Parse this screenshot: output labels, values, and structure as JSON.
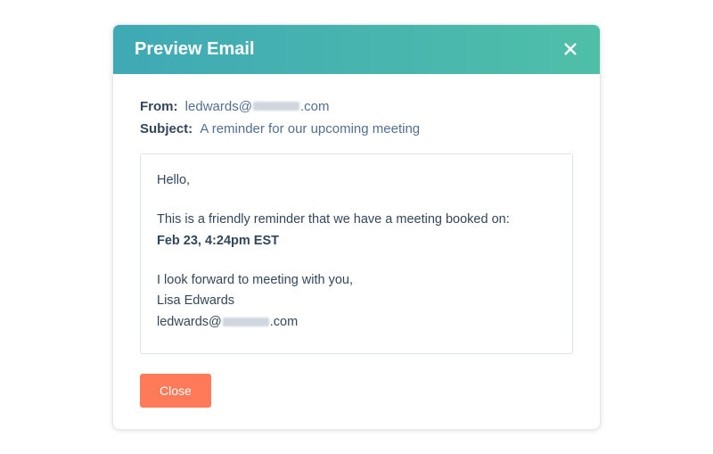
{
  "modal": {
    "title": "Preview Email",
    "from_label": "From:",
    "from_prefix": "ledwards@",
    "from_suffix": ".com",
    "subject_label": "Subject:",
    "subject_value": "A reminder for our upcoming meeting",
    "close_button_label": "Close"
  },
  "email": {
    "greeting": "Hello,",
    "reminder_intro": "This is a friendly reminder that we have a meeting booked on:",
    "meeting_time": "Feb 23, 4:24pm EST",
    "closing_line": "I look forward to meeting with you,",
    "sender_name": "Lisa Edwards",
    "sender_email_prefix": "ledwards@",
    "sender_email_suffix": ".com"
  }
}
